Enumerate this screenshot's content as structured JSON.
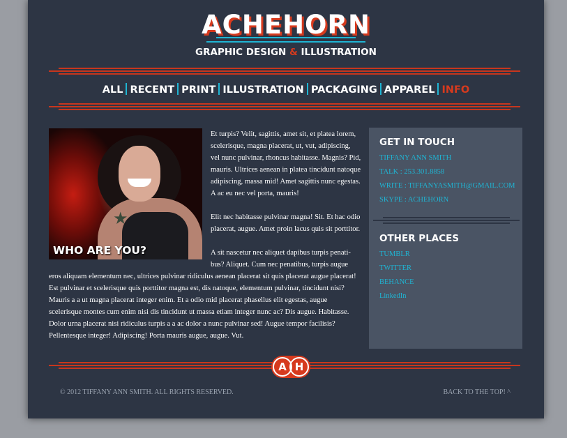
{
  "header": {
    "logo_title": "ACHEHORN",
    "logo_sub_before": "GRAPHIC DESIGN ",
    "logo_sub_amp": "&",
    "logo_sub_after": " ILLUSTRATION"
  },
  "nav": {
    "items": [
      {
        "label": "ALL",
        "active": false
      },
      {
        "label": "RECENT",
        "active": false
      },
      {
        "label": "PRINT",
        "active": false
      },
      {
        "label": "ILLUSTRATION",
        "active": false
      },
      {
        "label": "PACKAGING",
        "active": false
      },
      {
        "label": "APPAREL",
        "active": false
      },
      {
        "label": "INFO",
        "active": true
      }
    ]
  },
  "main": {
    "photo_caption": "WHO ARE YOU?",
    "paragraphs": [
      "Et turpis? Velit, sagittis, amet sit, et platea lorem, scelerisque, magna placerat, ut, vut, adipiscing, vel nunc pulvinar, rhoncus habitasse. Magnis? Pid, mauris. Ultrices aenean in platea tincidunt natoque adipiscing, massa mid! Amet sagittis nunc egestas. A ac eu nec vel porta, mauris!",
      "Elit nec habitasse pulvinar magna! Sit. Et hac odio placerat, augue. Amet proin lacus quis sit porttitor.",
      "A sit nascetur nec aliquet dapibus turpis penati-bus? Aliquet. Cum nec penatibus, turpis augue eros aliquam elementum nec, ultrices pulvinar ridiculus aenean placerat sit quis placerat augue placerat! Est pulvinar et scelerisque quis porttitor magna est, dis natoque, elementum pulvinar, tincidunt nisi? Mauris a a ut magna placerat integer enim. Et a odio mid placerat phasellus elit egestas, augue scelerisque montes cum enim nisi dis tincidunt ut massa etiam integer nunc ac? Dis augue. Habitasse. Dolor urna placerat nisi ridiculus turpis a a ac dolor a nunc pulvinar sed! Augue tempor facilisis? Pellentesque integer! Adipiscing! Porta mauris augue, augue. Vut."
    ]
  },
  "sidebar": {
    "contact_heading": "GET IN TOUCH",
    "contact_items": [
      "TIFFANY ANN SMITH",
      "TALK : 253.301.8858",
      "WRITE : TIFFANYASMITH@GMAIL.COM",
      "SKYPE : ACHEHORN"
    ],
    "places_heading": "OTHER PLACES",
    "places_items": [
      "TUMBLR",
      "TWITTER",
      "BEHANCE",
      "LinkedIn"
    ]
  },
  "footer": {
    "badge_left": "A",
    "badge_right": "H",
    "copyright": "© 2012 TIFFANY ANN SMITH. ALL RIGHTS RESERVED.",
    "back_to_top": "BACK TO THE TOP! ^"
  },
  "colors": {
    "background": "#2d3544",
    "accent_red": "#d63a1e",
    "accent_cyan": "#1fb5d4",
    "sidebar": "#4a5464"
  }
}
